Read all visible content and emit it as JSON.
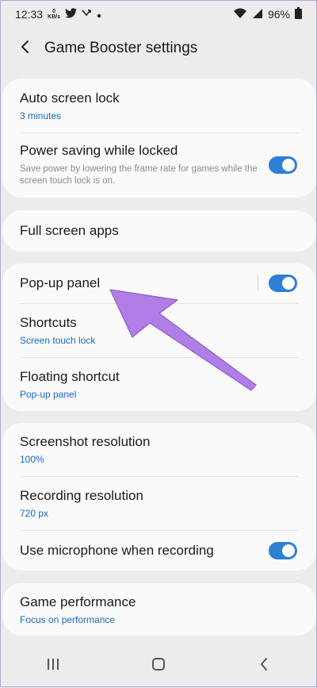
{
  "status": {
    "time": "12:33",
    "net_speed_value": "0",
    "net_speed_unit": "KB/s",
    "battery": "96%"
  },
  "header": {
    "title": "Game Booster settings"
  },
  "cards": {
    "lock": {
      "auto_screen_lock": {
        "title": "Auto screen lock",
        "sub": "3 minutes"
      },
      "power_saving": {
        "title": "Power saving while locked",
        "desc": "Save power by lowering the frame rate for games while the screen touch lock is on.",
        "enabled": true
      }
    },
    "full_screen": {
      "title": "Full screen apps"
    },
    "popup": {
      "popup_panel": {
        "title": "Pop-up panel",
        "enabled": true
      },
      "shortcuts": {
        "title": "Shortcuts",
        "sub": "Screen touch lock"
      },
      "floating_shortcut": {
        "title": "Floating shortcut",
        "sub": "Pop-up panel"
      }
    },
    "recording": {
      "screenshot_res": {
        "title": "Screenshot resolution",
        "sub": "100%"
      },
      "recording_res": {
        "title": "Recording resolution",
        "sub": "720 px"
      },
      "microphone": {
        "title": "Use microphone when recording",
        "enabled": true
      }
    },
    "performance": {
      "game_performance": {
        "title": "Game performance",
        "sub": "Focus on performance"
      }
    }
  },
  "colors": {
    "accent": "#2f7fd4",
    "link": "#1769c4",
    "annotation_arrow": "#b07ee6"
  },
  "icons": [
    "back-arrow-icon",
    "twitter-icon",
    "missed-call-icon",
    "wifi-icon",
    "signal-icon",
    "battery-icon",
    "recents-icon",
    "home-icon",
    "back-nav-icon"
  ]
}
